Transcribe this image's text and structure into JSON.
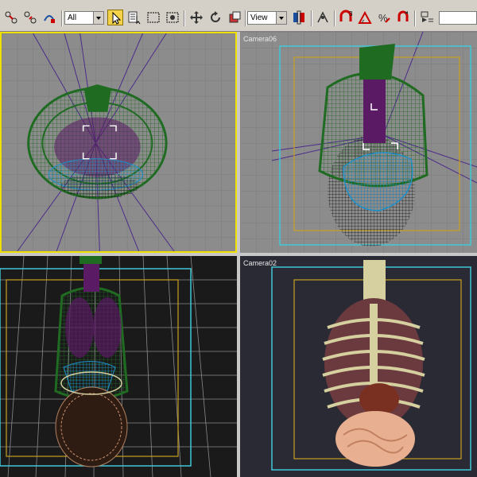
{
  "toolbar": {
    "selection_filter": "All",
    "reference_coord": "View"
  },
  "viewports": {
    "top_right_label": "Camera06",
    "bottom_right_label": "Camera02"
  },
  "colors": {
    "viewport_grey": "#8c8c8c",
    "active_border": "#f0e000",
    "wire_green": "#1f6b22",
    "wire_blue": "#1e90c8",
    "wire_purple": "#5a1a64",
    "safe_frame_yellow": "#c8a020",
    "safe_frame_cyan": "#40c8d8",
    "render_bg": "#2a2a34",
    "bone": "#d6cfa0"
  },
  "icons": [
    "select-link-icon",
    "unlink-icon",
    "bind-spacewarp-icon",
    "select-object-icon",
    "select-by-name-icon",
    "rect-selection-icon",
    "window-crossing-icon",
    "move-icon",
    "rotate-icon",
    "scale-icon",
    "pivot-icon",
    "mirror-icon",
    "snap-3-icon",
    "angle-snap-icon",
    "percent-snap-icon",
    "spinner-snap-icon",
    "edit-named-selection-icon"
  ]
}
